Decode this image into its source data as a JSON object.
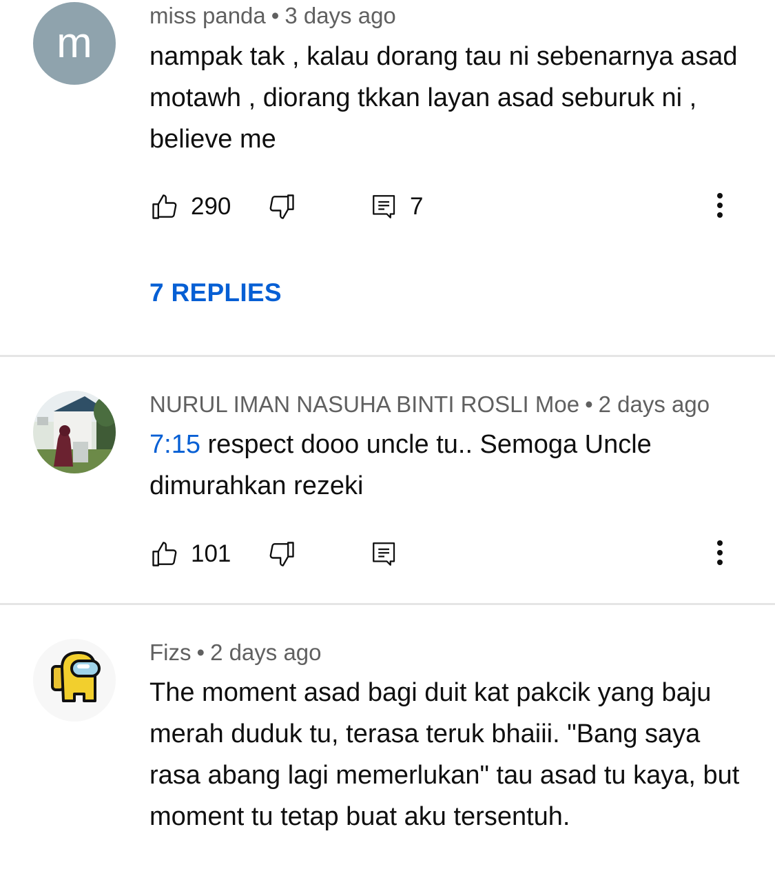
{
  "comments": [
    {
      "author": "miss panda",
      "separator": "•",
      "time": "3 days ago",
      "avatar_letter": "m",
      "avatar_color": "#8fa3ad",
      "text": "nampak tak , kalau dorang tau ni sebenarnya asad motawh , diorang tkkan layan asad seburuk ni , believe me",
      "likes": "290",
      "reply_count": "7",
      "replies_label": "7 REPLIES"
    },
    {
      "author": "NURUL IMAN NASUHA BINTI ROSLI Moe",
      "separator": "•",
      "time": "2 days ago",
      "timestamp_link": "7:15",
      "text": " respect dooo uncle tu.. Semoga Uncle dimurahkan rezeki",
      "likes": "101"
    },
    {
      "author": "Fizs",
      "separator": "•",
      "time": "2 days ago",
      "text": "The moment asad bagi duit kat pakcik yang baju merah duduk tu, terasa teruk bhaiii. \"Bang saya rasa abang lagi memerlukan\" tau asad tu kaya, but moment tu tetap buat aku tersentuh."
    }
  ],
  "colors": {
    "link_blue": "#065fd4",
    "meta_gray": "#606060",
    "divider": "#e5e5e5",
    "text": "#0f0f0f"
  },
  "icons": [
    "thumbs-up-icon",
    "thumbs-down-icon",
    "reply-icon",
    "more-vert-icon",
    "among-us-character-icon"
  ]
}
